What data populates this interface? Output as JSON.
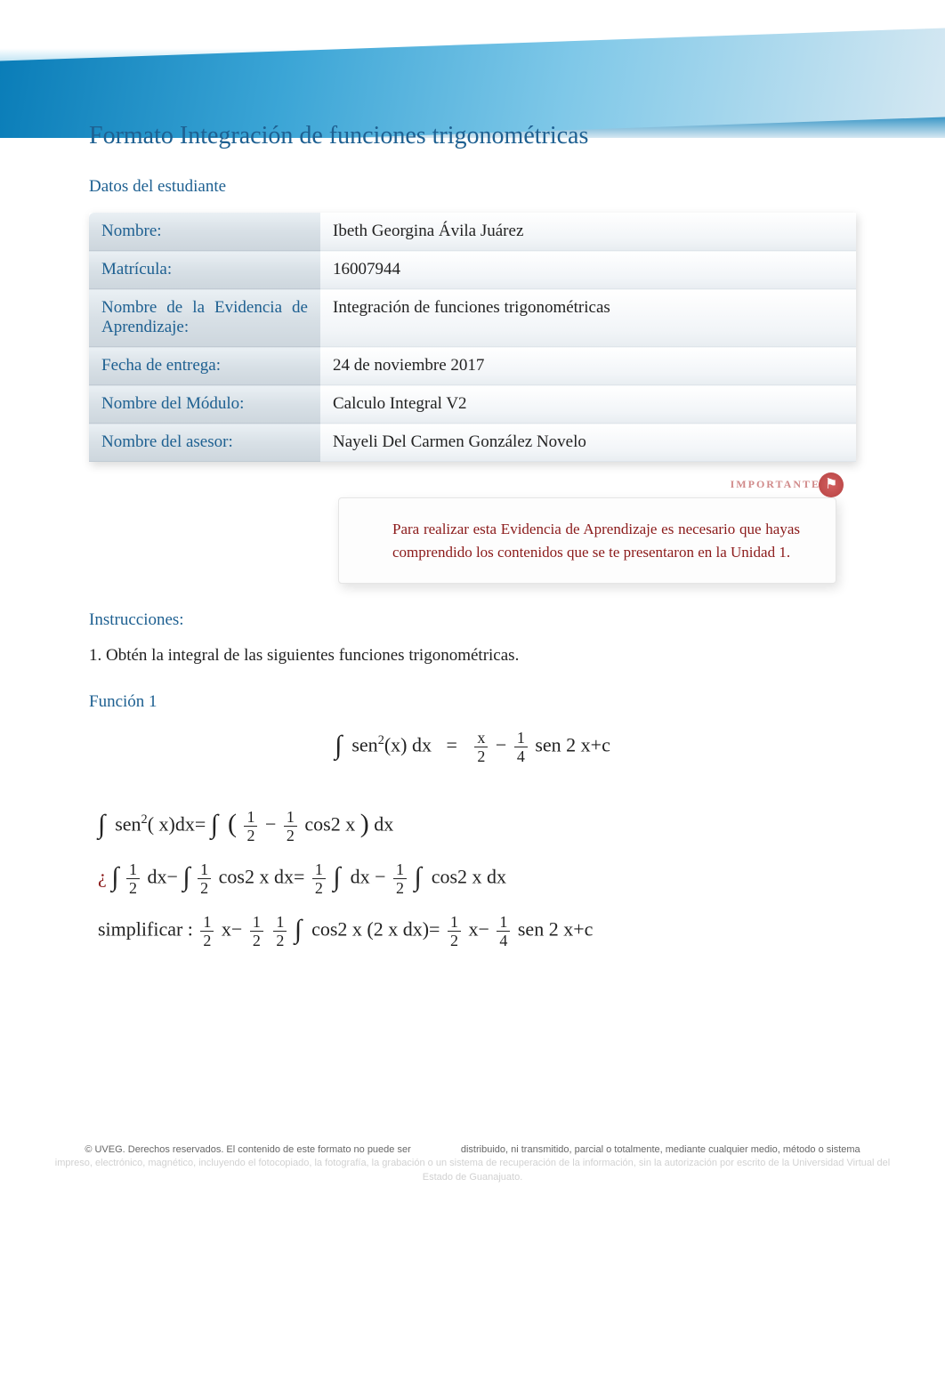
{
  "title": "Formato Integración de funciones trigonométricas",
  "sections": {
    "student_data_heading": "Datos del estudiante",
    "instructions_heading": "Instrucciones:",
    "function1_heading": "Función 1"
  },
  "student_table": {
    "rows": [
      {
        "label": "Nombre:",
        "value": "Ibeth Georgina Ávila Juárez"
      },
      {
        "label": "Matrícula:",
        "value": "16007944"
      },
      {
        "label": "Nombre de la Evidencia de Aprendizaje:",
        "value": "Integración de funciones trigonométricas"
      },
      {
        "label": "Fecha de entrega:",
        "value": "24 de noviembre 2017"
      },
      {
        "label": "Nombre del Módulo:",
        "value": "Calculo Integral V2"
      },
      {
        "label": "Nombre del asesor:",
        "value": "Nayeli Del Carmen González Novelo"
      }
    ]
  },
  "important_box": {
    "label": "IMPORTANTE",
    "text": "Para realizar esta Evidencia de Aprendizaje es necesario que hayas comprendido los contenidos que se te presentaron en la Unidad 1."
  },
  "instruction_text": "1. Obtén la integral de las siguientes funciones trigonométricas.",
  "math": {
    "eq1_lhs_a": "sen",
    "eq1_lhs_exp": "2",
    "eq1_lhs_b": "(x) dx",
    "equals": "=",
    "x": "x",
    "two": "2",
    "one": "1",
    "four": "4",
    "minus": "−",
    "sen2xc": "sen 2 x+c",
    "step1_a": "sen",
    "step1_b": "( x)dx=",
    "cos2x": "cos2 x",
    "dx": "dx",
    "qm": "¿",
    "cos2xdx": "cos2 x dx=",
    "dx_minus": "dx −",
    "cos2x_dx": "cos2 x dx",
    "simplificar": "simplificar :",
    "x_minus": "x−",
    "cos2x_2xdx": "cos2 x (2 x dx)="
  },
  "footer": {
    "line1a": "© UVEG. Derechos reservados. El contenido de este formato no puede ser",
    "line1b": "distribuido, ni transmitido, parcial o totalmente, mediante cualquier medio, método o sistema",
    "line2": "impreso, electrónico, magnético, incluyendo el fotocopiado, la fotografía, la grabación o un sistema de recuperación de la información, sin la autorización por escrito de la Universidad Virtual del Estado de Guanajuato."
  }
}
